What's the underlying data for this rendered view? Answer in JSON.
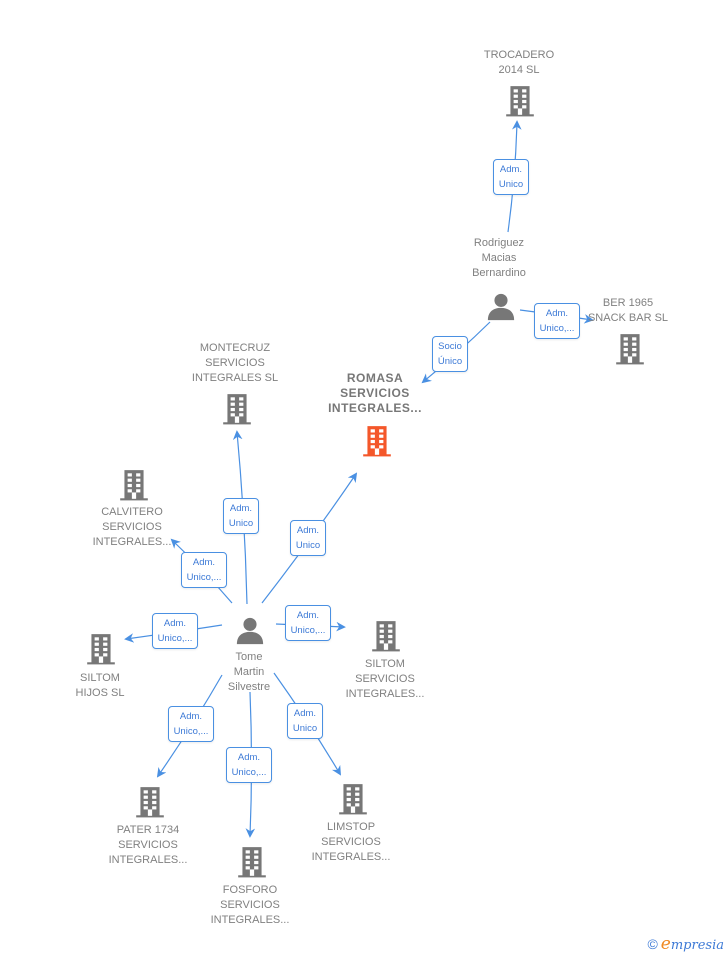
{
  "colors": {
    "edge": "#4a90e2",
    "node_icon": "#777777",
    "focus_icon": "#f4572a",
    "label_text": "#808080"
  },
  "nodes": [
    {
      "id": "trocadero",
      "type": "company",
      "label": "TROCADERO\n2014  SL"
    },
    {
      "id": "rodriguez",
      "type": "person",
      "label": "Rodriguez\nMacias\nBernardino"
    },
    {
      "id": "ber1965",
      "type": "company",
      "label": "BER 1965\nSNACK BAR  SL"
    },
    {
      "id": "montecruz",
      "type": "company",
      "label": "MONTECRUZ\nSERVICIOS\nINTEGRALES SL"
    },
    {
      "id": "romasa",
      "type": "company",
      "focus": true,
      "label": "ROMASA\nSERVICIOS\nINTEGRALES..."
    },
    {
      "id": "calvitero",
      "type": "company",
      "label": "CALVITERO\nSERVICIOS\nINTEGRALES..."
    },
    {
      "id": "tome",
      "type": "person",
      "label": "Tome\nMartin\nSilvestre"
    },
    {
      "id": "siltom_hijos",
      "type": "company",
      "label": "SILTOM\nHIJOS  SL"
    },
    {
      "id": "siltom_servicios",
      "type": "company",
      "label": "SILTOM\nSERVICIOS\nINTEGRALES..."
    },
    {
      "id": "pater1734",
      "type": "company",
      "label": "PATER 1734\nSERVICIOS\nINTEGRALES..."
    },
    {
      "id": "fosforo",
      "type": "company",
      "label": "FOSFORO\nSERVICIOS\nINTEGRALES..."
    },
    {
      "id": "limstop",
      "type": "company",
      "label": "LIMSTOP\nSERVICIOS\nINTEGRALES..."
    }
  ],
  "edges": [
    {
      "from": "rodriguez",
      "to": "trocadero",
      "label": "Adm.\nUnico"
    },
    {
      "from": "rodriguez",
      "to": "ber1965",
      "label": "Adm.\nUnico,..."
    },
    {
      "from": "rodriguez",
      "to": "romasa",
      "label": "Socio\nÚnico"
    },
    {
      "from": "tome",
      "to": "montecruz",
      "label": "Adm.\nUnico"
    },
    {
      "from": "tome",
      "to": "romasa",
      "label": "Adm.\nUnico"
    },
    {
      "from": "tome",
      "to": "calvitero",
      "label": "Adm.\nUnico,..."
    },
    {
      "from": "tome",
      "to": "siltom_hijos",
      "label": "Adm.\nUnico,..."
    },
    {
      "from": "tome",
      "to": "siltom_servicios",
      "label": "Adm.\nUnico,..."
    },
    {
      "from": "tome",
      "to": "pater1734",
      "label": "Adm.\nUnico,..."
    },
    {
      "from": "tome",
      "to": "fosforo",
      "label": "Adm.\nUnico,..."
    },
    {
      "from": "tome",
      "to": "limstop",
      "label": "Adm.\nUnico"
    }
  ],
  "footer": {
    "copyright_symbol": "©",
    "brand_initial": "e",
    "brand_rest": "mpresia"
  }
}
